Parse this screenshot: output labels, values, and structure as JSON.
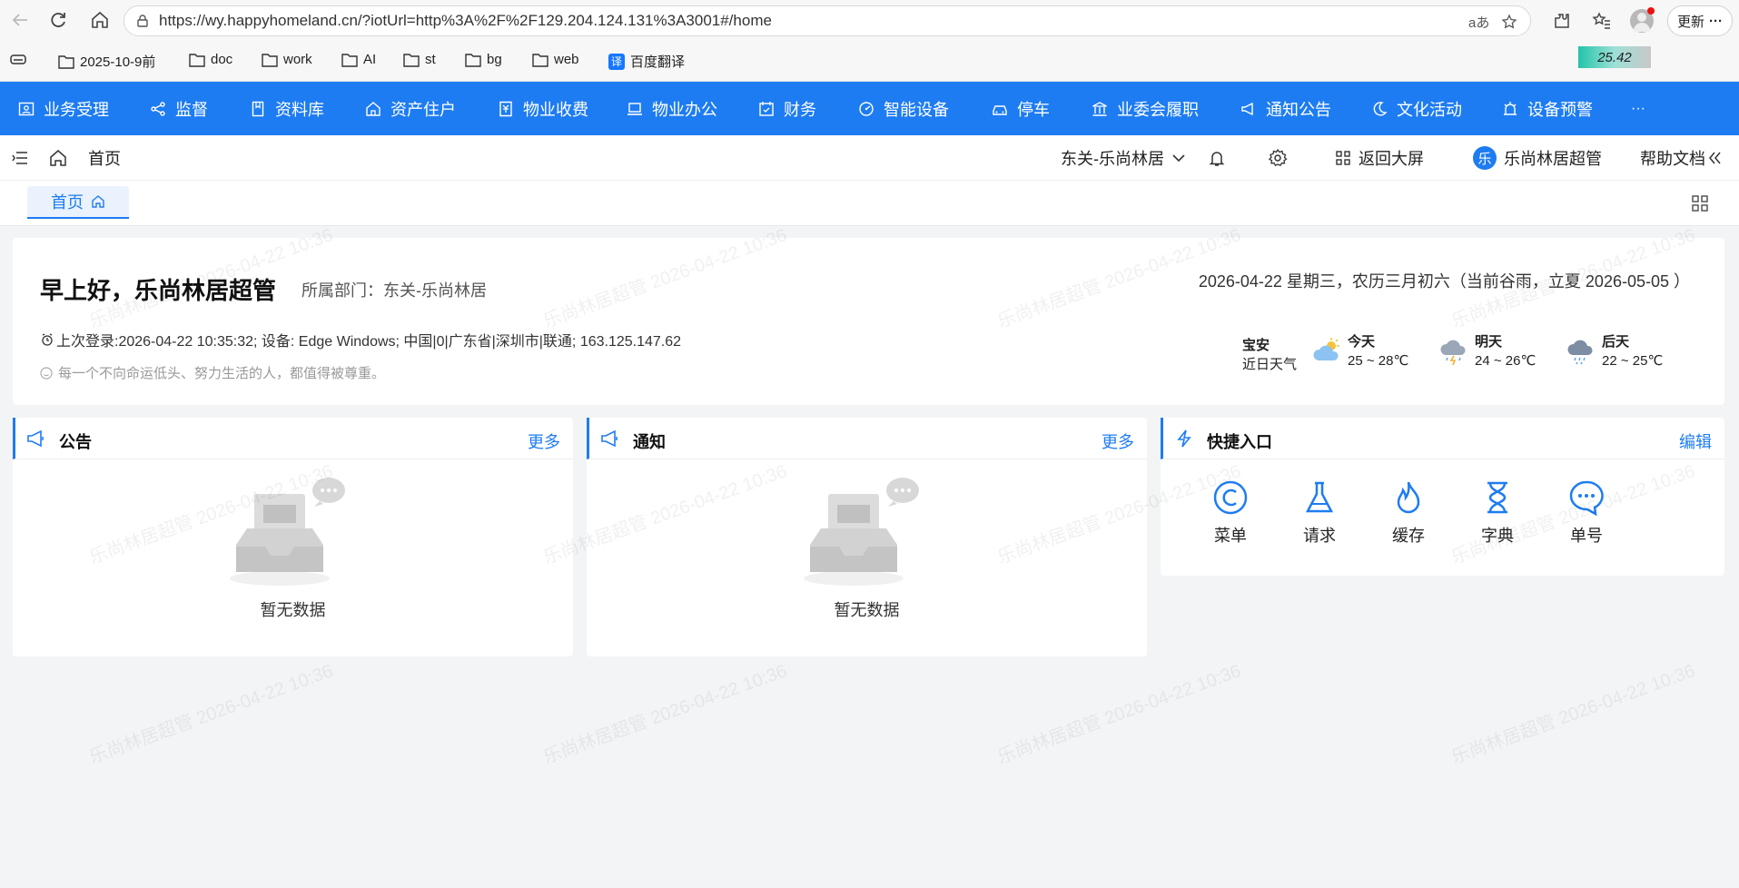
{
  "browser": {
    "url": "https://wy.happyhomeland.cn/?iotUrl=http%3A%2F%2F129.204.124.131%3A3001#/home",
    "update_label": "更新",
    "bookmarks": [
      "2025-10-9前",
      "doc",
      "work",
      "AI",
      "st",
      "bg",
      "web"
    ],
    "translate_bookmark": "百度翻译",
    "translate_badge": "译",
    "time_badge": "25.42"
  },
  "nav": {
    "items": [
      "业务受理",
      "监督",
      "资料库",
      "资产住户",
      "物业收费",
      "物业办公",
      "财务",
      "智能设备",
      "停车",
      "业委会履职",
      "通知公告",
      "文化活动",
      "设备预警"
    ],
    "more": "···"
  },
  "header": {
    "home": "首页",
    "community": "东关-乐尚林居",
    "back_to_screen": "返回大屏",
    "avatar_char": "乐",
    "user": "乐尚林居超管",
    "help": "帮助文档"
  },
  "tabs": {
    "home": "首页"
  },
  "welcome": {
    "greeting": "早上好，乐尚林居超管",
    "dept": "所属部门：东关-乐尚林居",
    "login_info": "上次登录:2026-04-22 10:35:32; 设备: Edge Windows; 中国|0|广东省|深圳市|联通; 163.125.147.62",
    "motto": "每一个不向命运低头、努力生活的人，都值得被尊重。",
    "date_line": "2026-04-22 星期三，农历三月初六（当前谷雨，立夏 2026-05-05 ）",
    "weather": {
      "location": "宝安",
      "label": "近日天气",
      "days": [
        {
          "name": "今天",
          "range": "25 ~ 28℃",
          "icon": "sun-cloud-icon"
        },
        {
          "name": "明天",
          "range": "24 ~ 26℃",
          "icon": "thunder-rain-icon"
        },
        {
          "name": "后天",
          "range": "22 ~ 25℃",
          "icon": "rain-icon"
        }
      ]
    }
  },
  "panels": {
    "announcement": {
      "title": "公告",
      "more": "更多",
      "empty": "暂无数据"
    },
    "notice": {
      "title": "通知",
      "more": "更多",
      "empty": "暂无数据"
    },
    "quick": {
      "title": "快捷入口",
      "edit": "编辑",
      "items": [
        "菜单",
        "请求",
        "缓存",
        "字典",
        "单号"
      ]
    }
  },
  "watermark": "乐尚林居超管 2026-04-22 10:36",
  "colors": {
    "primary": "#1e7cf2",
    "background": "#f3f4f6"
  }
}
